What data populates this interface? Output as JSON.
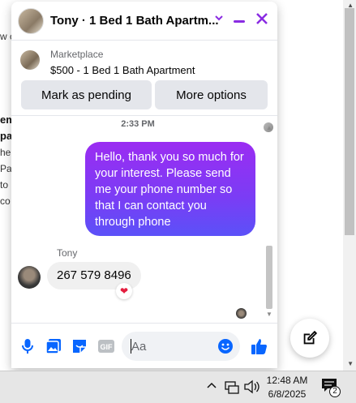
{
  "background_page": {
    "fragments": [
      {
        "text": "w c"
      },
      {
        "text": "em"
      },
      {
        "text": "pa"
      },
      {
        "text": "he"
      },
      {
        "text": "Par"
      },
      {
        "text": "to"
      },
      {
        "text": "co"
      }
    ]
  },
  "chat": {
    "header": {
      "title": "Tony · 1 Bed 1 Bath Apartm...",
      "chevron_icon": "chevron-down-icon",
      "minimize_icon": "minimize-icon",
      "close_icon": "close-icon",
      "accent_color": "#8a2be2"
    },
    "marketplace": {
      "label": "Marketplace",
      "listing": "$500 - 1 Bed 1 Bath Apartment"
    },
    "actions": {
      "mark_pending": "Mark as pending",
      "more_options": "More options"
    },
    "messages": {
      "timestamp": "2:33 PM",
      "sent": "Hello, thank you so much for your interest. Please send me your phone number so that I can contact you through phone",
      "sender_name": "Tony",
      "received": "267 579 8496",
      "reaction": "❤"
    },
    "composer": {
      "placeholder": "Aa",
      "icons": [
        "microphone-icon",
        "photo-icon",
        "sticker-icon",
        "gif-icon",
        "emoji-icon",
        "thumbs-up-icon"
      ],
      "gif_label": "GIF"
    }
  },
  "taskbar": {
    "time": "12:48 AM",
    "date": "6/8/2025",
    "notification_count": "2"
  }
}
